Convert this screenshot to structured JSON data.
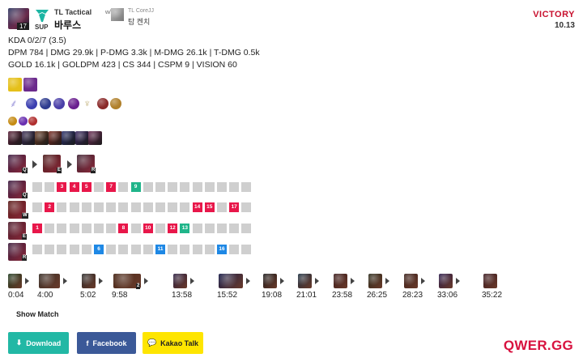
{
  "header": {
    "champion_level": "17",
    "role": "SUP",
    "team_name": "TL Tactical",
    "player_name": "바루스",
    "with_label": "w/",
    "duo_team": "TL CoreJJ",
    "duo_name": "탐 켄치",
    "result": "VICTORY",
    "version": "10.13"
  },
  "stats": {
    "kda": "KDA 0/2/7 (3.5)",
    "damage": "DPM 784 | DMG 29.9k | P-DMG 3.3k | M-DMG 26.1k | T-DMG 0.5k",
    "economy": "GOLD 16.1k | GOLDPM 423 | CS 344 | CSPM 9 | VISION 60"
  },
  "icons": {
    "spells": [
      {
        "name": "flash-spell-icon",
        "color": "#e5c01a"
      },
      {
        "name": "cleanse-spell-icon",
        "color": "#6b2a8c"
      }
    ],
    "runes": [
      {
        "name": "lethal-tempo-rune-icon",
        "color": "#8e87d6"
      },
      {
        "name": "sorcery-rune-icon",
        "color": "#3b3fb0"
      },
      {
        "name": "nimbus-rune-icon",
        "color": "#2e3c8f"
      },
      {
        "name": "transcendence-rune-icon",
        "color": "#4a3fa8"
      },
      {
        "name": "gathering-storm-rune-icon",
        "color": "#6a1f8f"
      },
      {
        "name": "precision-tree-icon",
        "color": "#b09a52"
      },
      {
        "name": "legend-bloodline-rune-icon",
        "color": "#8a2a2a"
      },
      {
        "name": "cut-down-rune-icon",
        "color": "#b0802b"
      }
    ],
    "shards": [
      {
        "name": "attack-speed-shard-icon",
        "color": "#c58b14"
      },
      {
        "name": "adaptive-shard-icon",
        "color": "#6a2fb0"
      },
      {
        "name": "armor-shard-icon",
        "color": "#b02f2f"
      }
    ],
    "items": [
      {
        "name": "item-guinsoo-icon",
        "color": "#5a2038"
      },
      {
        "name": "item-nashor-icon",
        "color": "#3a2a52"
      },
      {
        "name": "item-bow-icon",
        "color": "#6a3a22"
      },
      {
        "name": "item-berserker-icon",
        "color": "#7a2a20"
      },
      {
        "name": "item-witsend-icon",
        "color": "#2a2e6a"
      },
      {
        "name": "item-lich-icon",
        "color": "#3a2660"
      },
      {
        "name": "item-rageblade-icon",
        "color": "#6a2a52"
      }
    ]
  },
  "skill_order": {
    "keys": [
      "Q",
      "E",
      "R"
    ]
  },
  "skill_grid": {
    "rows": [
      {
        "key": "Q",
        "cells": [
          "",
          "",
          "3",
          "4",
          "5",
          "",
          "7",
          "",
          "9",
          "",
          "",
          "",
          "",
          "",
          "",
          "",
          "",
          ""
        ]
      },
      {
        "key": "W",
        "cells": [
          "",
          "2",
          "",
          "",
          "",
          "",
          "",
          "",
          "",
          "",
          "",
          "",
          "",
          "14",
          "15",
          "",
          "17",
          ""
        ]
      },
      {
        "key": "E",
        "cells": [
          "1",
          "",
          "",
          "",
          "",
          "",
          "",
          "8",
          "",
          "10",
          "",
          "12",
          "13",
          "",
          "",
          "",
          "",
          ""
        ]
      },
      {
        "key": "R",
        "cells": [
          "",
          "",
          "",
          "",
          "",
          "6",
          "",
          "",
          "",
          "",
          "11",
          "",
          "",
          "",
          "",
          "16",
          "",
          ""
        ]
      }
    ]
  },
  "build": {
    "steps": [
      {
        "time": "0:04"
      },
      {
        "time": "4:00"
      },
      {
        "time": "5:02"
      },
      {
        "time": "9:58"
      },
      {
        "time": "13:58"
      },
      {
        "time": "15:52"
      },
      {
        "time": "19:08"
      },
      {
        "time": "21:01"
      },
      {
        "time": "23:58"
      },
      {
        "time": "26:25"
      },
      {
        "time": "28:23"
      },
      {
        "time": "33:06"
      },
      {
        "time": "35:22"
      }
    ],
    "badge": "2"
  },
  "actions": {
    "show_match": "Show Match",
    "download": "Download",
    "facebook": "Facebook",
    "kakao": "Kakao Talk"
  },
  "brand": "QWER.GG"
}
